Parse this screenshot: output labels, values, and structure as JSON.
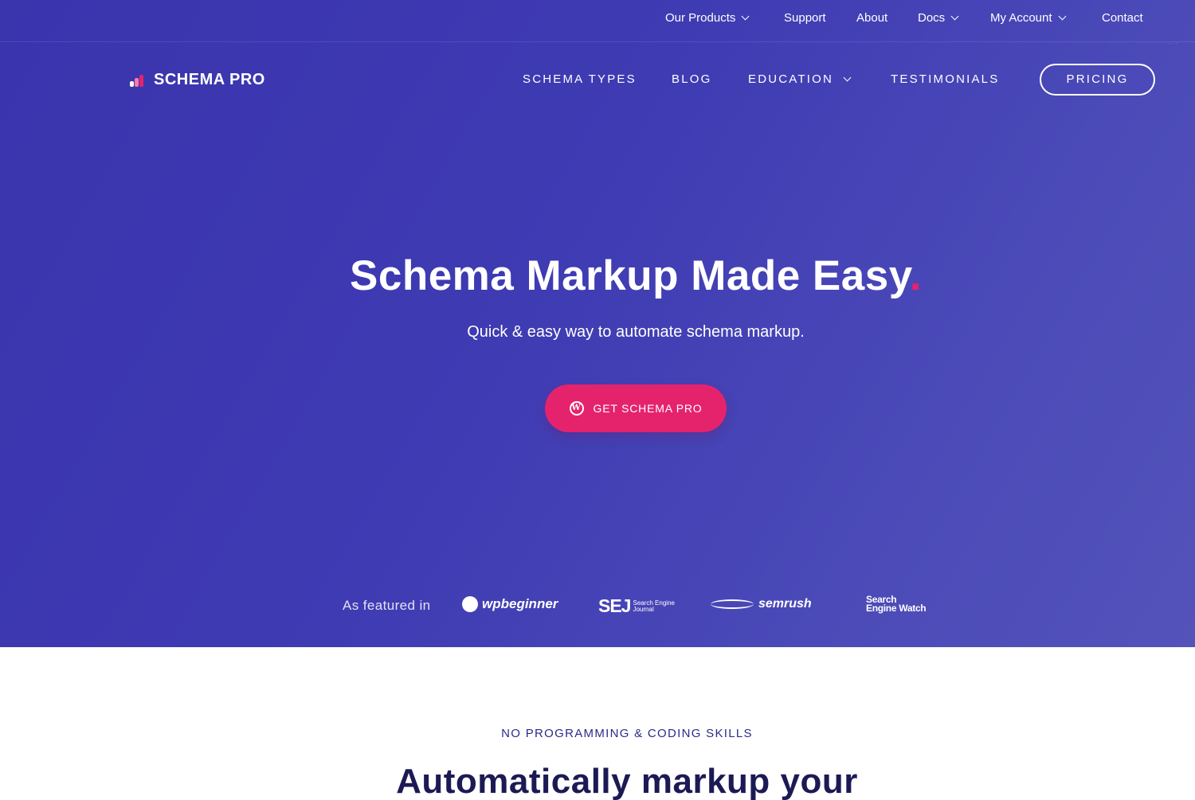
{
  "topbar": {
    "items": [
      {
        "label": "Our Products",
        "dropdown": true
      },
      {
        "label": "Support",
        "dropdown": false
      },
      {
        "label": "About",
        "dropdown": false
      },
      {
        "label": "Docs",
        "dropdown": true
      },
      {
        "label": "My Account",
        "dropdown": true
      },
      {
        "label": "Contact",
        "dropdown": false
      }
    ]
  },
  "brand": {
    "logo_text": "SCHEMA PRO",
    "logo_icon": "bar-chart-logo-icon"
  },
  "mainnav": {
    "items": [
      {
        "label": "SCHEMA TYPES"
      },
      {
        "label": "BLOG"
      },
      {
        "label": "EDUCATION",
        "dropdown": true
      },
      {
        "label": "TESTIMONIALS"
      }
    ],
    "pricing_label": "PRICING"
  },
  "hero": {
    "headline": "Schema Markup Made Easy",
    "headline_dot": ".",
    "subheadline": "Quick & easy way to automate schema markup.",
    "cta_label": "GET SCHEMA PRO",
    "cta_icon": "wordpress-icon"
  },
  "featured": {
    "label": "As featured in",
    "logos": {
      "wpbeginner": "wpbeginner",
      "sej_big": "SEJ",
      "sej_small_1": "Search Engine",
      "sej_small_2": "Journal",
      "semrush": "semrush",
      "sew_1": "Search",
      "sew_2": "Engine Watch"
    }
  },
  "section": {
    "kicker": "NO PROGRAMMING & CODING SKILLS",
    "title": "Automatically markup your"
  },
  "colors": {
    "hero_bg": "#3f3bb3",
    "accent_pink": "#e5236d",
    "section_title": "#1c1a55",
    "kicker": "#2b2b8a"
  }
}
